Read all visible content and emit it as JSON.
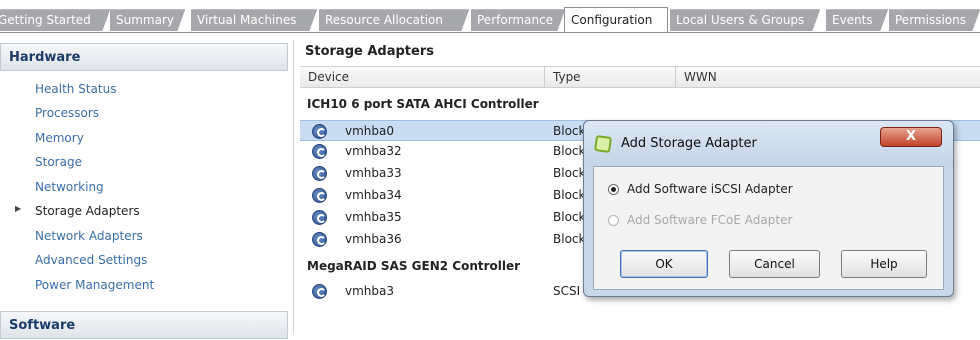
{
  "tabs": [
    {
      "label": "Getting Started",
      "active": false
    },
    {
      "label": "Summary",
      "active": false
    },
    {
      "label": "Virtual Machines",
      "active": false
    },
    {
      "label": "Resource Allocation",
      "active": false
    },
    {
      "label": "Performance",
      "active": false
    },
    {
      "label": "Configuration",
      "active": true
    },
    {
      "label": "Local Users & Groups",
      "active": false
    },
    {
      "label": "Events",
      "active": false
    },
    {
      "label": "Permissions",
      "active": false
    }
  ],
  "sidebar": {
    "hardware_title": "Hardware",
    "items": [
      {
        "label": "Health Status",
        "selected": false
      },
      {
        "label": "Processors",
        "selected": false
      },
      {
        "label": "Memory",
        "selected": false
      },
      {
        "label": "Storage",
        "selected": false
      },
      {
        "label": "Networking",
        "selected": false
      },
      {
        "label": "Storage Adapters",
        "selected": true
      },
      {
        "label": "Network Adapters",
        "selected": false
      },
      {
        "label": "Advanced Settings",
        "selected": false
      },
      {
        "label": "Power Management",
        "selected": false
      }
    ],
    "software_title": "Software"
  },
  "storage": {
    "title": "Storage Adapters",
    "columns": [
      "Device",
      "Type",
      "WWN"
    ],
    "groups": [
      {
        "name": "ICH10 6 port SATA AHCI Controller",
        "rows": [
          {
            "device": "vmhba0",
            "type": "Block SCSI",
            "selected": true
          },
          {
            "device": "vmhba32",
            "type": "Block SCSI",
            "selected": false
          },
          {
            "device": "vmhba33",
            "type": "Block SCSI",
            "selected": false
          },
          {
            "device": "vmhba34",
            "type": "Block SCSI",
            "selected": false
          },
          {
            "device": "vmhba35",
            "type": "Block SCSI",
            "selected": false
          },
          {
            "device": "vmhba36",
            "type": "Block SCSI",
            "selected": false
          }
        ]
      },
      {
        "name": "MegaRAID SAS GEN2 Controller",
        "rows": [
          {
            "device": "vmhba3",
            "type": "SCSI",
            "selected": false
          }
        ]
      }
    ]
  },
  "dialog": {
    "title": "Add Storage Adapter",
    "close_label": "X",
    "options": [
      {
        "label": "Add Software iSCSI Adapter",
        "checked": true,
        "enabled": true
      },
      {
        "label": "Add Software FCoE Adapter",
        "checked": false,
        "enabled": false
      }
    ],
    "ok_label": "OK",
    "cancel_label": "Cancel",
    "help_label": "Help"
  }
}
